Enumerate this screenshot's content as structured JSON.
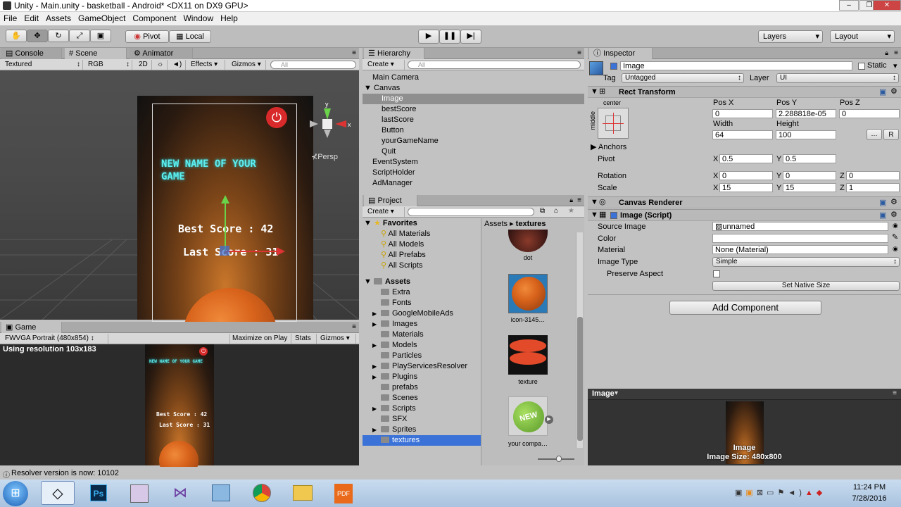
{
  "window": {
    "title": "Unity - Main.unity - basketball - Android* <DX11 on DX9 GPU>"
  },
  "menu": [
    "File",
    "Edit",
    "Assets",
    "GameObject",
    "Component",
    "Window",
    "Help"
  ],
  "toolbar": {
    "pivot": "Pivot",
    "local": "Local",
    "layers": "Layers",
    "layout": "Layout"
  },
  "scene_tabs": {
    "console": "Console",
    "scene": "Scene",
    "animator": "Animator"
  },
  "scene_bar": {
    "draw_mode": "Textured",
    "render_mode": "RGB",
    "toggle_2d": "2D",
    "effects": "Effects",
    "gizmos": "Gizmos",
    "search_placeholder": "All"
  },
  "persp_label": "Persp",
  "game_content": {
    "title": "NEW NAME OF YOUR GAME",
    "best": "Best Score : 42",
    "last": "Last Score : 31"
  },
  "scene_best_partial": "Best Score : 42",
  "scene_last_partial": "Last Score : 31",
  "game_panel": {
    "tab": "Game",
    "resolution": "FWVGA Portrait (480x854)",
    "maximize": "Maximize on Play",
    "stats": "Stats",
    "gizmos": "Gizmos",
    "using": "Using resolution 103x183"
  },
  "hierarchy": {
    "tab": "Hierarchy",
    "create": "Create",
    "items": [
      {
        "label": "Main Camera",
        "indent": 0
      },
      {
        "label": "Canvas",
        "indent": 0,
        "expanded": true
      },
      {
        "label": "Image",
        "indent": 1,
        "selected": true
      },
      {
        "label": "bestScore",
        "indent": 1
      },
      {
        "label": "lastScore",
        "indent": 1
      },
      {
        "label": "Button",
        "indent": 1
      },
      {
        "label": "yourGameName",
        "indent": 1
      },
      {
        "label": "Quit",
        "indent": 1
      },
      {
        "label": "EventSystem",
        "indent": 0
      },
      {
        "label": "ScriptHolder",
        "indent": 0
      },
      {
        "label": "AdManager",
        "indent": 0
      }
    ]
  },
  "project": {
    "tab": "Project",
    "create": "Create",
    "favorites_label": "Favorites",
    "favorites": [
      "All Materials",
      "All Models",
      "All Prefabs",
      "All Scripts"
    ],
    "assets_label": "Assets",
    "folders": [
      {
        "label": "Extra",
        "arrow": false
      },
      {
        "label": "Fonts",
        "arrow": false
      },
      {
        "label": "GoogleMobileAds",
        "arrow": true
      },
      {
        "label": "Images",
        "arrow": true
      },
      {
        "label": "Materials",
        "arrow": false
      },
      {
        "label": "Models",
        "arrow": true
      },
      {
        "label": "Particles",
        "arrow": false
      },
      {
        "label": "PlayServicesResolver",
        "arrow": true
      },
      {
        "label": "Plugins",
        "arrow": true
      },
      {
        "label": "prefabs",
        "arrow": false
      },
      {
        "label": "Scenes",
        "arrow": false
      },
      {
        "label": "Scripts",
        "arrow": true
      },
      {
        "label": "SFX",
        "arrow": false
      },
      {
        "label": "Sprites",
        "arrow": true
      },
      {
        "label": "textures",
        "arrow": false,
        "selected": true
      }
    ],
    "breadcrumb_root": "Assets",
    "breadcrumb_sep": "▸",
    "breadcrumb_leaf": "textures",
    "assets": [
      {
        "label": "dot"
      },
      {
        "label": "icon-3145…"
      },
      {
        "label": "texture"
      },
      {
        "label": "your compa…"
      }
    ],
    "new_badge": "NEW"
  },
  "inspector": {
    "tab": "Inspector",
    "object_name": "Image",
    "static": "Static",
    "tag_label": "Tag",
    "tag_value": "Untagged",
    "layer_label": "Layer",
    "layer_value": "UI",
    "rect_transform": "Rect Transform",
    "anchor_h": "center",
    "anchor_v": "middle",
    "pos_x_label": "Pos X",
    "pos_y_label": "Pos Y",
    "pos_z_label": "Pos Z",
    "pos_x": "0",
    "pos_y": "2.288818e-05",
    "pos_z": "0",
    "width_label": "Width",
    "height_label": "Height",
    "width": "64",
    "height": "100",
    "r_button": "R",
    "anchors": "Anchors",
    "pivot_label": "Pivot",
    "pivot_x": "0.5",
    "pivot_y": "0.5",
    "rotation_label": "Rotation",
    "rot_x": "0",
    "rot_y": "0",
    "rot_z": "0",
    "scale_label": "Scale",
    "scale_x": "15",
    "scale_y": "15",
    "scale_z": "1",
    "axis_x": "X",
    "axis_y": "Y",
    "axis_z": "Z",
    "canvas_renderer": "Canvas Renderer",
    "image_script": "Image (Script)",
    "source_image_label": "Source Image",
    "source_image": "unnamed",
    "color_label": "Color",
    "material_label": "Material",
    "material": "None (Material)",
    "image_type_label": "Image Type",
    "image_type": "Simple",
    "preserve_label": "Preserve Aspect",
    "set_native": "Set Native Size",
    "add_component": "Add Component",
    "preview_title": "Image",
    "preview_name": "Image",
    "preview_size": "Image Size: 480x800"
  },
  "statusbar": {
    "text": "Resolver version is now: 10102"
  },
  "clock": {
    "time": "11:24 PM",
    "date": "7/28/2016"
  }
}
